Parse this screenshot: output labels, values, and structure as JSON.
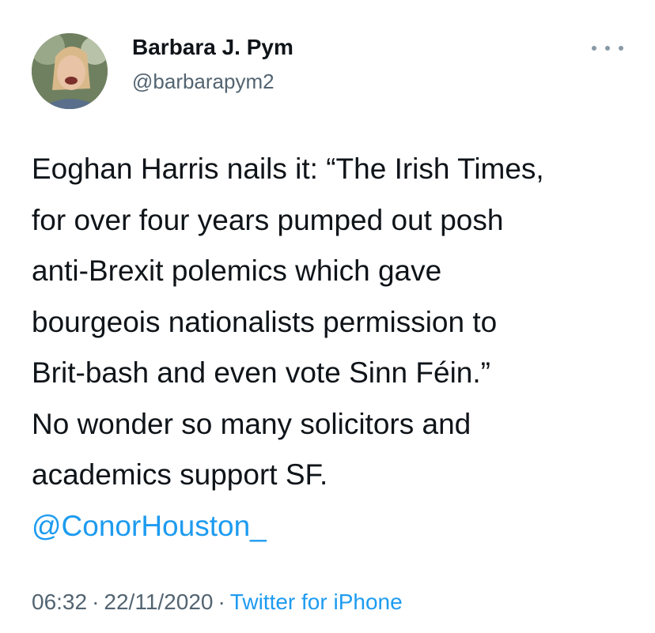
{
  "author": {
    "name": "Barbara J. Pym",
    "handle": "@barbarapym2"
  },
  "tweet": {
    "lines": [
      "Eoghan Harris nails it: “The Irish Times,",
      "for over four years pumped out posh",
      "anti-Brexit polemics which gave",
      "bourgeois nationalists permission to",
      "Brit-bash and even vote Sinn Féin.”",
      "No wonder so many solicitors and",
      "academics support SF."
    ],
    "mention": "@ConorHouston_"
  },
  "meta": {
    "time": "06:32",
    "separator": "·",
    "date": "22/11/2020",
    "source": "Twitter for iPhone"
  },
  "colors": {
    "link": "#1d9bf0",
    "secondary": "#536471",
    "text": "#0f1419"
  },
  "icons": {
    "more": "more-horizontal-icon"
  }
}
